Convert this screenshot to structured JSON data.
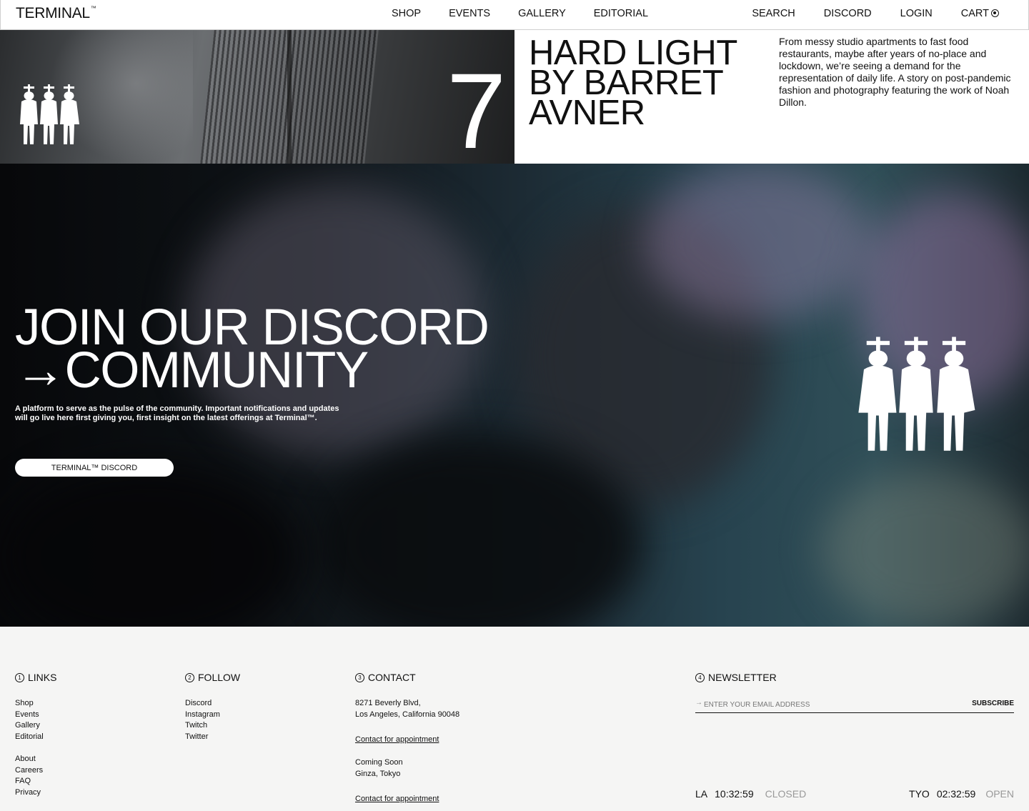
{
  "header": {
    "logo": "TERMINAL",
    "logo_tm": "™",
    "nav_center": [
      "SHOP",
      "EVENTS",
      "GALLERY",
      "EDITORIAL"
    ],
    "nav_right": {
      "search": "SEARCH",
      "discord": "DISCORD",
      "login": "LOGIN",
      "cart": "CART"
    }
  },
  "editorial": {
    "number": "7",
    "title": "HARD LIGHT BY BARRET AVNER",
    "description": "From messy studio apartments to fast food restaurants, maybe after years of no-place and lockdown, we’re seeing a demand for the representation of daily life. A story on post-pandemic fashion and photography featuring the work of Noah Dillon."
  },
  "hero": {
    "title_line1": "JOIN OUR DISCORD",
    "title_line2": "→COMMUNITY",
    "description": "A platform to serve as the pulse of the community. Important notifications and updates will go live here first giving you, first insight on the latest offerings at Terminal™.",
    "button": "TERMINAL™ DISCORD"
  },
  "footer": {
    "links": {
      "number": "1",
      "heading": "LINKS",
      "group1": [
        "Shop",
        "Events",
        "Gallery",
        "Editorial"
      ],
      "group2": [
        "About",
        "Careers",
        "FAQ",
        "Privacy"
      ]
    },
    "follow": {
      "number": "2",
      "heading": "FOLLOW",
      "items": [
        "Discord",
        "Instagram",
        "Twitch",
        "Twitter"
      ]
    },
    "contact": {
      "number": "3",
      "heading": "CONTACT",
      "address_line1": "8271 Beverly Blvd,",
      "address_line2": "Los Angeles, California 90048",
      "appointment1": "Contact for appointment",
      "coming_soon": "Coming Soon",
      "tokyo": "Ginza, Tokyo",
      "appointment2": "Contact for appointment"
    },
    "newsletter": {
      "number": "4",
      "heading": "NEWSLETTER",
      "arrow": "→",
      "placeholder": "ENTER YOUR EMAIL ADDRESS",
      "subscribe": "SUBSCRIBE"
    },
    "clocks": {
      "la": {
        "city": "LA",
        "time": "10:32:59",
        "status": "CLOSED"
      },
      "tyo": {
        "city": "TYO",
        "time": "02:32:59",
        "status": "OPEN"
      }
    }
  },
  "colors": {
    "hero_dark": "#07080a",
    "hero_teal": "#304f58",
    "footer_bg": "#f5f5f4",
    "muted": "#999999"
  }
}
